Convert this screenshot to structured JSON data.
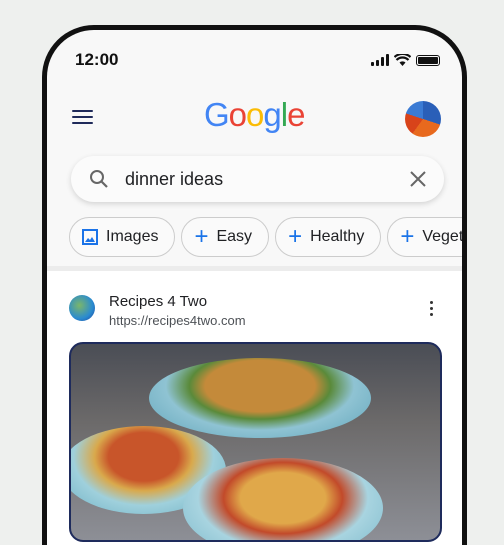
{
  "status": {
    "time": "12:00"
  },
  "header": {
    "logo": "Google"
  },
  "search": {
    "query": "dinner ideas"
  },
  "chips": [
    {
      "label": "Images",
      "icon": "image-icon"
    },
    {
      "label": "Easy",
      "icon": "plus-icon"
    },
    {
      "label": "Healthy",
      "icon": "plus-icon"
    },
    {
      "label": "Veget",
      "icon": "plus-icon"
    }
  ],
  "result": {
    "site_name": "Recipes 4 Two",
    "url": "https://recipes4two.com"
  },
  "colors": {
    "google_blue": "#4285F4",
    "google_red": "#EA4335",
    "google_yellow": "#FBBC05",
    "google_green": "#34A853",
    "chip_accent": "#1a73e8"
  }
}
